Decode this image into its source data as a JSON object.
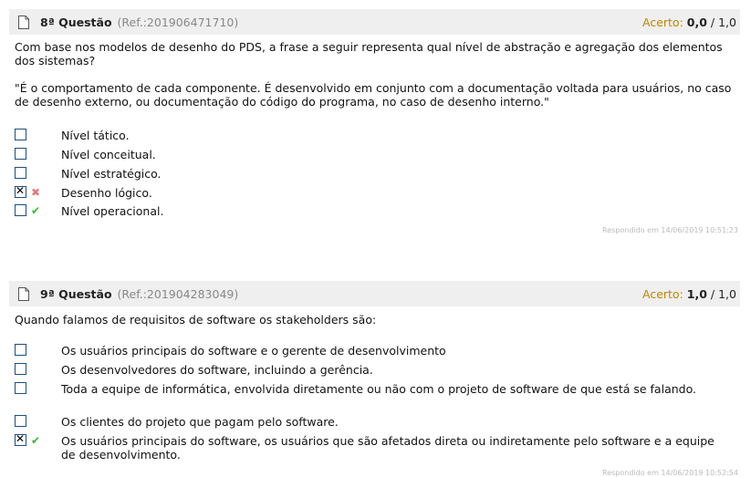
{
  "q8": {
    "title": "8ª Questão",
    "ref": "(Ref.:201906471710)",
    "score_label": "Acerto:",
    "score_value": "0,0",
    "score_total": "/ 1,0",
    "prompt": "Com base nos modelos de desenho do PDS, a frase a seguir representa qual nível de abstração e agregação dos elementos dos sistemas?",
    "quote": "\"É o comportamento de cada componente. É desenvolvido em conjunto com a documentação voltada para usuários, no caso de desenho externo, ou documentação do código do programa, no caso de desenho interno.\"",
    "options": [
      {
        "label": "Nível tático.",
        "checked": false,
        "mark": ""
      },
      {
        "label": "Nível conceitual.",
        "checked": false,
        "mark": ""
      },
      {
        "label": "Nível estratégico.",
        "checked": false,
        "mark": ""
      },
      {
        "label": "Desenho lógico.",
        "checked": true,
        "mark": "wrong"
      },
      {
        "label": "Nível operacional.",
        "checked": false,
        "mark": "right"
      }
    ],
    "answered": "Respondido em 14/06/2019 10:51:23"
  },
  "q9": {
    "title": "9ª Questão",
    "ref": "(Ref.:201904283049)",
    "score_label": "Acerto:",
    "score_value": "1,0",
    "score_total": "/ 1,0",
    "prompt": "Quando falamos de requisitos de software os stakeholders são:",
    "options": [
      {
        "label": "Os usuários principais do software e o gerente de desenvolvimento",
        "checked": false,
        "mark": ""
      },
      {
        "label": "Os desenvolvedores do software, incluindo a gerência.",
        "checked": false,
        "mark": ""
      },
      {
        "label": "Toda a equipe de informática, envolvida diretamente ou não com o projeto de software de que está se falando.",
        "checked": false,
        "mark": ""
      },
      {
        "label": "Os clientes do projeto que pagam pelo software.",
        "checked": false,
        "mark": ""
      },
      {
        "label": "Os usuários principais do software, os usuários que são afetados direta ou indiretamente pelo software e a equipe de desenvolvimento.",
        "checked": true,
        "mark": "right"
      }
    ],
    "answered": "Respondido em 14/06/2019 10:52:54"
  },
  "icons": {
    "wrong": "✖",
    "right": "✔"
  }
}
